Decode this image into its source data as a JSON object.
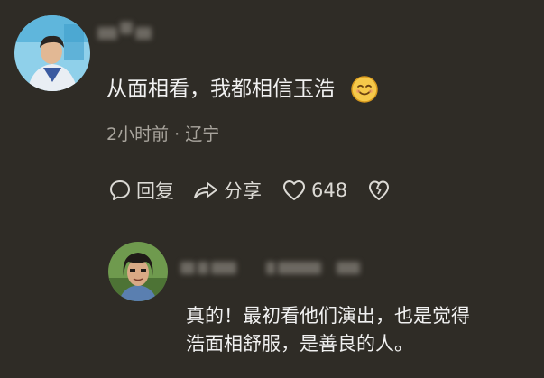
{
  "comment": {
    "text": "从面相看，我都相信玉浩",
    "meta": "2小时前 · 辽宁",
    "emoji_icon": "smiling-face-emoji"
  },
  "actions": {
    "reply_label": "回复",
    "share_label": "分享",
    "like_count": "648"
  },
  "reply": {
    "line1": "真的！最初看他们演出，也是觉得",
    "line2": "浩面相舒服，是善良的人。"
  },
  "colors": {
    "background": "#2f2c26",
    "text": "#f1f1f1",
    "meta": "#a9a59d",
    "icon": "#dcdad5"
  }
}
